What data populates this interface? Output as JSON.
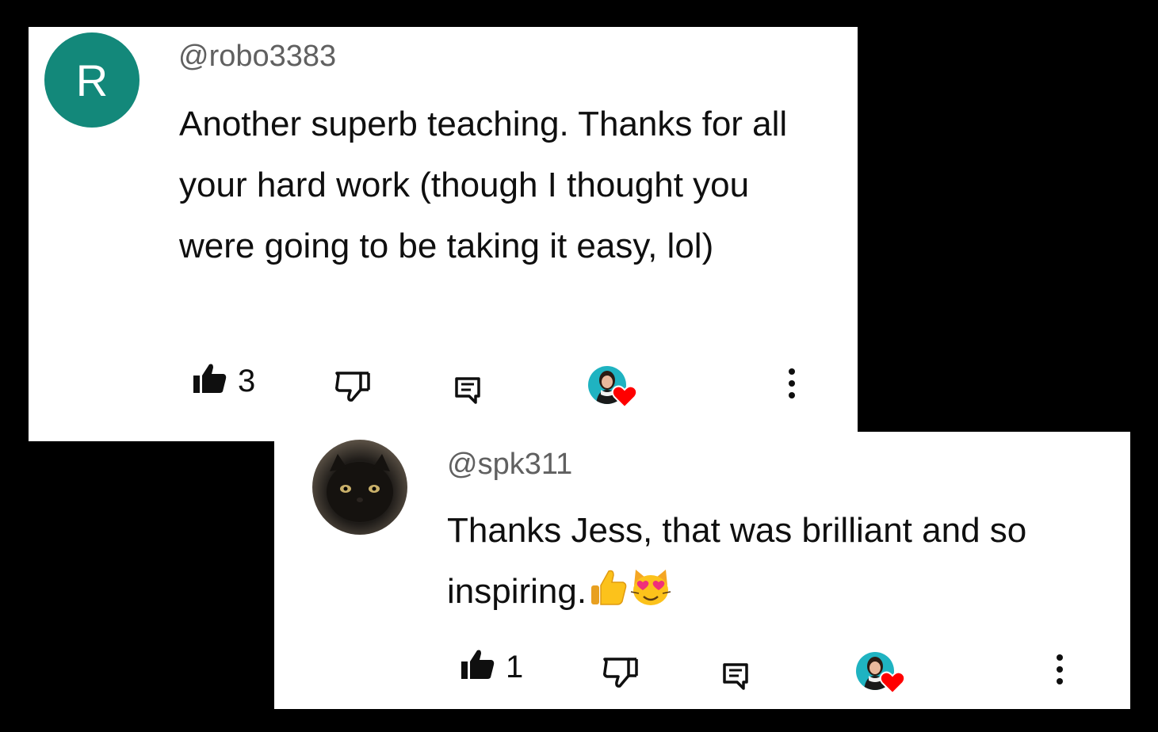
{
  "comments": [
    {
      "avatar_letter": "R",
      "avatar_color": "#13887a",
      "handle": "@robo3383",
      "text": "Another superb teaching. Thanks for all your hard work (though I thought you were going to be taking it easy, lol)",
      "like_count": "3",
      "creator_heart": true
    },
    {
      "avatar_type": "photo-black-cat",
      "handle": "@spk311",
      "text": "Thanks Jess, that was brilliant and so inspiring.",
      "emojis": [
        "thumbs-up-emoji",
        "heart-eyes-cat-emoji"
      ],
      "like_count": "1",
      "creator_heart": true
    }
  ],
  "icons": {
    "like": "thumbs-up-icon",
    "dislike": "thumbs-down-icon",
    "reply": "reply-comment-icon",
    "creator_heart": "creator-heart-badge",
    "more": "more-vertical-icon"
  },
  "colors": {
    "background": "#000000",
    "card": "#ffffff",
    "text": "#0f0f0f",
    "handle": "#606060",
    "heart": "#ff0000",
    "creator_avatar_bg": "#1fb3c1"
  }
}
